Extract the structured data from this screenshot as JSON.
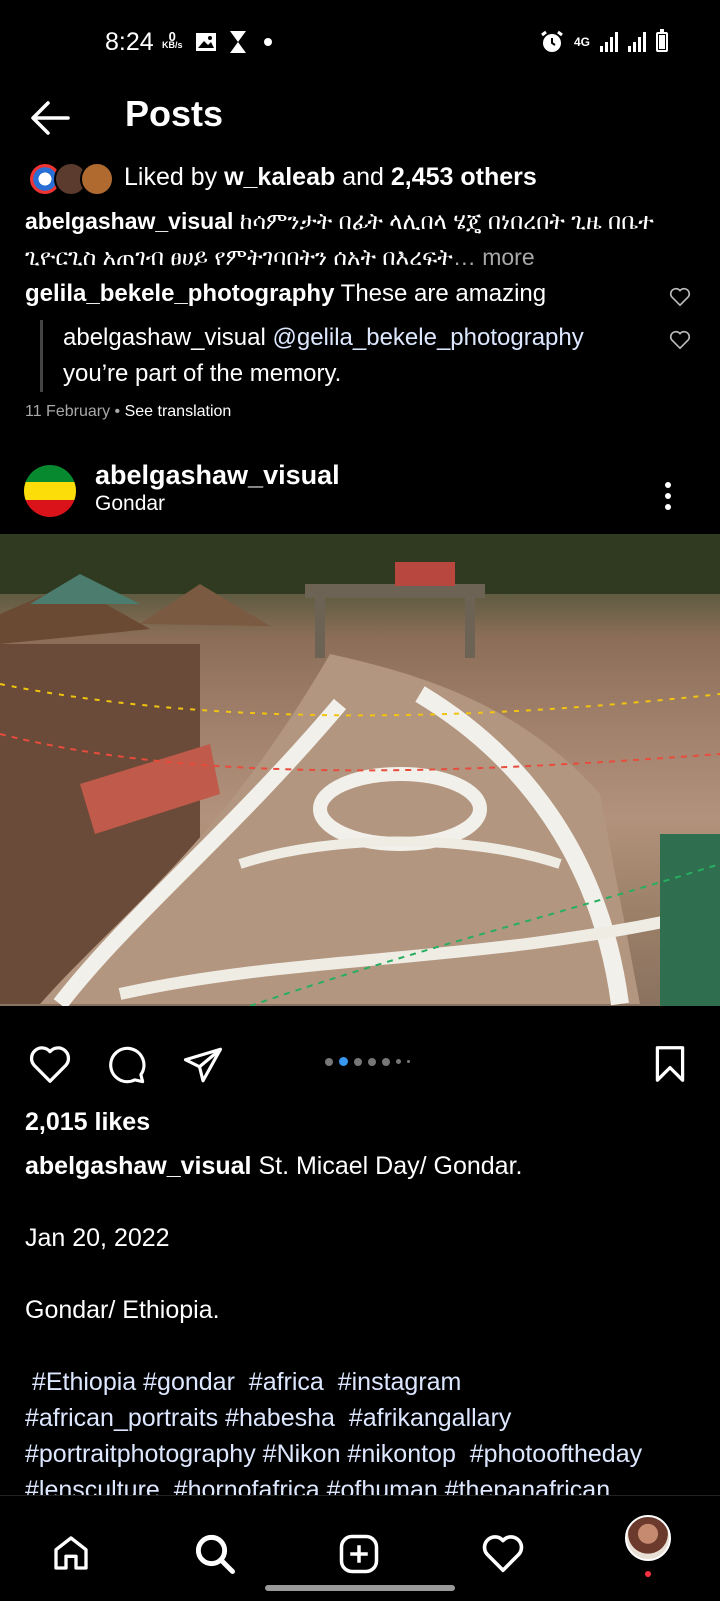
{
  "status_bar": {
    "time": "8:24",
    "net_speed": "0",
    "net_unit": "KB/s",
    "network": "4G"
  },
  "header": {
    "title": "Posts"
  },
  "previous_post": {
    "liked_prefix": "Liked by ",
    "liked_user": "w_kaleab",
    "liked_mid": " and ",
    "liked_others": "2,453 others",
    "caption_user": "abelgashaw_visual",
    "caption_text": " ከሳምንታት በፊት ላሊበላ ሄጄ በነበረበት ጊዜ በቤተ ጊዮርጊስ አጠገብ ፀሀይ የምትገባበትን ሰአት በእረፍት",
    "more": "… more",
    "comment_user": "gelila_bekele_photography",
    "comment_text": " These are amazing",
    "reply_user": "abelgashaw_visual",
    "reply_mention": " @gelila_bekele_photography",
    "reply_text": "you’re part of the memory.",
    "date": "11 February",
    "see_translation": "See translation"
  },
  "post": {
    "username": "abelgashaw_visual",
    "location": "Gondar",
    "likes": "2,015 likes",
    "caption_user": "abelgashaw_visual",
    "caption_line1": " St. Micael Day/ Gondar.",
    "caption_date": "Jan 20, 2022",
    "caption_place": "Gondar/ Ethiopia.",
    "hashtags_1": " #Ethiopia #gondar  #africa  #instagram",
    "hashtags_2": "#african_portraits #habesha  #afrikangallary",
    "hashtags_3": "#portraitphotography #Nikon #nikontop  #photooftheday",
    "hashtags_4": "#lensculture  #hornofafrica #ofhuman #thepanafrican"
  },
  "colors": {
    "accent": "#3897f0",
    "notif": "#ff3040",
    "flag_green": "#078930",
    "flag_yellow": "#fcdd09",
    "flag_red": "#da121a"
  }
}
